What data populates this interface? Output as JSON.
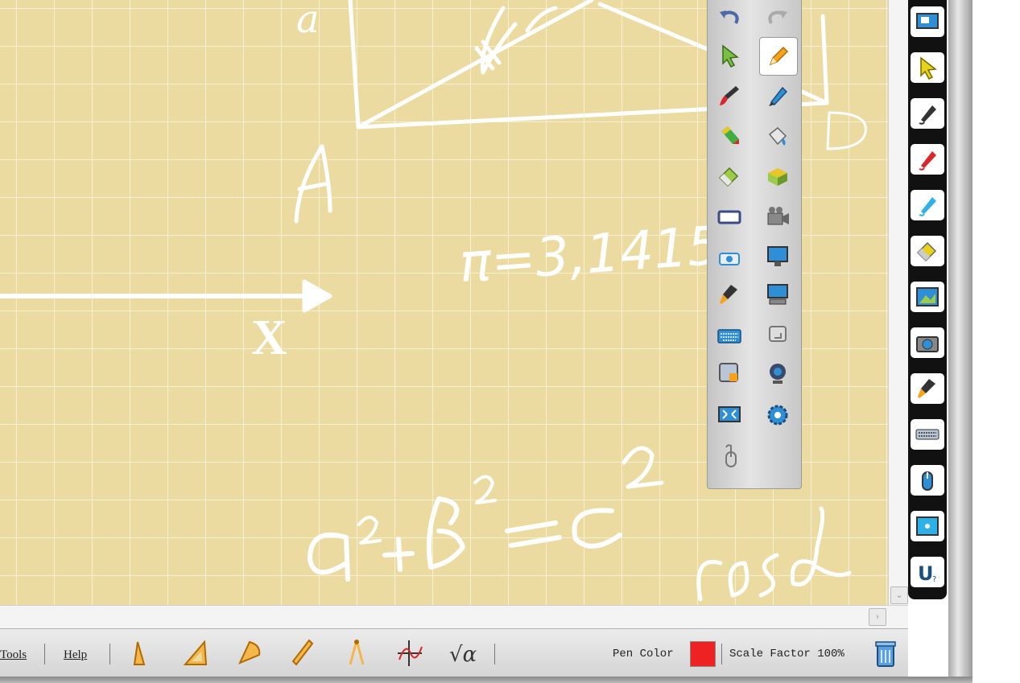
{
  "menu": {
    "tools_label": "Tools",
    "help_label": "Help"
  },
  "status": {
    "pen_color_label": "Pen Color",
    "pen_color": "#ee2222",
    "scale_factor_label": "Scale Factor 100%"
  },
  "board": {
    "background_color": "#ecdba0",
    "ink_color": "#ffffff",
    "texts": {
      "vertex_a": "a",
      "vertex_A": "A",
      "vertex_D": "D",
      "axis_x": "X",
      "pi_value": "π=3,1415",
      "pythagoras_a": "a",
      "pythagoras_b": "b",
      "pythagoras_c": "c",
      "exponent": "2",
      "plus": "+",
      "equals": "=",
      "cos": "cosd"
    }
  },
  "floating_toolbar": {
    "tools": [
      "undo-icon",
      "redo-icon",
      "select-icon",
      "pencil-icon",
      "brush-icon",
      "pen-icon",
      "highlighter-icon",
      "fill-icon",
      "eraser-icon",
      "cube-icon",
      "rectangle-icon",
      "camera-icon",
      "screenshot-icon",
      "monitor-icon",
      "spotlight-icon",
      "screen-icon",
      "keyboard-icon",
      "return-icon",
      "lock-icon",
      "webcam-icon",
      "fullscreen-icon",
      "settings-icon",
      "mouse-icon"
    ]
  },
  "right_toolbar": {
    "tools": [
      "screen-icon",
      "select-icon",
      "pen-icon",
      "red-pen-icon",
      "blue-pen-icon",
      "eraser-icon",
      "image-icon",
      "camera-icon",
      "spotlight-icon",
      "keyboard-icon",
      "mouse-icon",
      "display-icon",
      "u-logo-icon"
    ]
  }
}
